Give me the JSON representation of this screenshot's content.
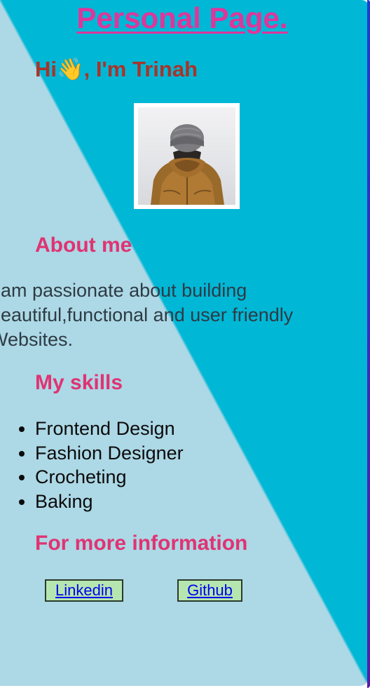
{
  "header": {
    "title": "Personal Page."
  },
  "intro": {
    "greeting": "Hi👋, I'm Trinah",
    "photo_alt": "Person in a beanie and brown jacket, seen from behind"
  },
  "about": {
    "heading": "About me",
    "text": "I am passionate about building beautiful,functional and user friendly Websites."
  },
  "skills": {
    "heading": "My skills",
    "items": [
      "Frontend Design",
      "Fashion Designer",
      "Crocheting",
      "Baking"
    ]
  },
  "contact": {
    "heading": "For more information",
    "links": [
      {
        "label": "Linkedin"
      },
      {
        "label": "Github"
      }
    ]
  },
  "colors": {
    "background_light": "#add8e6",
    "background_dark": "#00b7d6",
    "title": "#e0359a",
    "greeting": "#a8342a",
    "headings": "#e03372",
    "link_button": "#b6e6b0"
  }
}
